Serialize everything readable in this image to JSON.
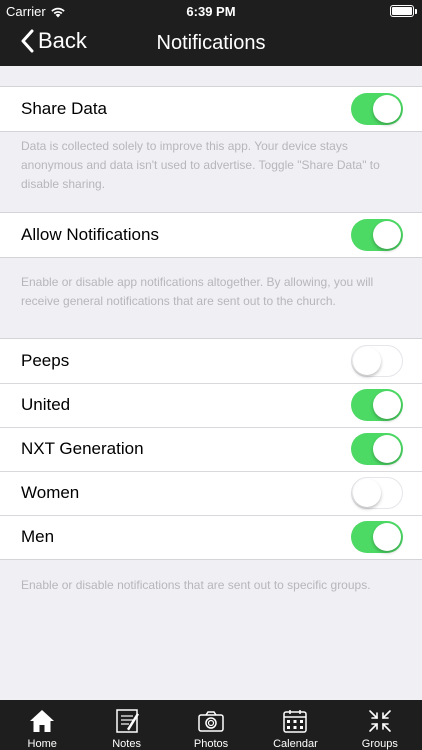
{
  "status_bar": {
    "carrier": "Carrier",
    "time": "6:39 PM"
  },
  "nav": {
    "back_label": "Back",
    "title": "Notifications"
  },
  "share": {
    "label": "Share Data",
    "on": true,
    "note": "Data is collected solely to improve this app. Your device stays anonymous and data isn't used to advertise. Toggle \"Share Data\" to disable sharing."
  },
  "allow": {
    "label": "Allow Notifications",
    "on": true,
    "note": "Enable or disable app notifications altogether. By allowing, you will receive general notifications that are sent out to the church."
  },
  "groups": {
    "items": [
      {
        "label": "Peeps",
        "on": false
      },
      {
        "label": "United",
        "on": true
      },
      {
        "label": "NXT Generation",
        "on": true
      },
      {
        "label": "Women",
        "on": false
      },
      {
        "label": "Men",
        "on": true
      }
    ],
    "note": "Enable or disable notifications that are sent out to specific groups."
  },
  "tabs": [
    {
      "label": "Home",
      "icon": "home-icon"
    },
    {
      "label": "Notes",
      "icon": "notes-icon"
    },
    {
      "label": "Photos",
      "icon": "camera-icon"
    },
    {
      "label": "Calendar",
      "icon": "calendar-icon"
    },
    {
      "label": "Groups",
      "icon": "groups-icon"
    }
  ],
  "colors": {
    "toggle_on": "#4cd964",
    "bar": "#1e1e1e",
    "background": "#efeff4"
  }
}
